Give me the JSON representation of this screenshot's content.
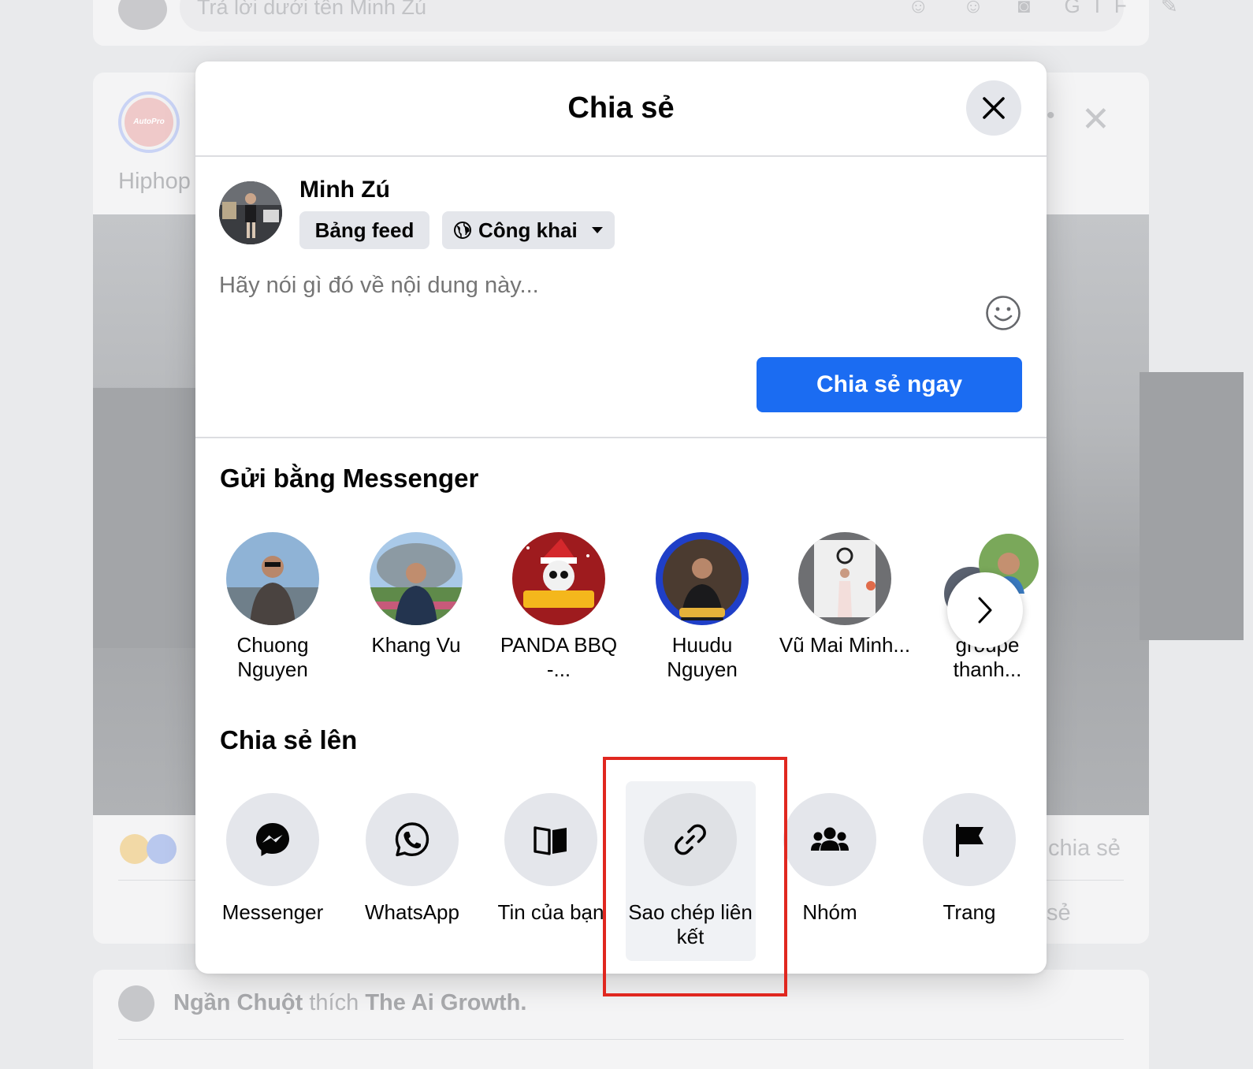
{
  "background": {
    "reply_placeholder": "Trả lời dưới tên Minh Zú",
    "reply_icons": "☺ ☺ ◙ GIF ✎",
    "page_avatar_text": "AutoPro",
    "post_text": "Hiphop",
    "shares_text": "chia sẻ",
    "share_action": "sẻ",
    "activity": {
      "actor": "Ngần Chuột",
      "verb": "thích",
      "object": "The Ai Growth."
    }
  },
  "dialog": {
    "title": "Chia sẻ",
    "composer": {
      "user_name": "Minh Zú",
      "destination": "Bảng feed",
      "privacy": "Công khai",
      "placeholder": "Hãy nói gì đó về nội dung này..."
    },
    "share_now_label": "Chia sẻ ngay",
    "messenger_section": {
      "title": "Gửi bằng Messenger",
      "contacts": [
        {
          "name": "Chuong Nguyen"
        },
        {
          "name": "Khang Vu"
        },
        {
          "name": "PANDA BBQ -..."
        },
        {
          "name": "Huudu Nguyen"
        },
        {
          "name": "Vũ Mai Minh..."
        },
        {
          "name": "groupe thanh..."
        }
      ]
    },
    "share_to_section": {
      "title": "Chia sẻ lên",
      "targets": [
        {
          "label": "Messenger",
          "icon": "messenger-icon"
        },
        {
          "label": "WhatsApp",
          "icon": "whatsapp-icon"
        },
        {
          "label": "Tin của bạn",
          "icon": "book-icon"
        },
        {
          "label": "Sao chép liên kết",
          "icon": "link-icon"
        },
        {
          "label": "Nhóm",
          "icon": "group-icon"
        },
        {
          "label": "Trang",
          "icon": "flag-icon"
        }
      ]
    }
  },
  "colors": {
    "primary_button": "#1b6cf2",
    "highlight_box": "#e0271f"
  }
}
